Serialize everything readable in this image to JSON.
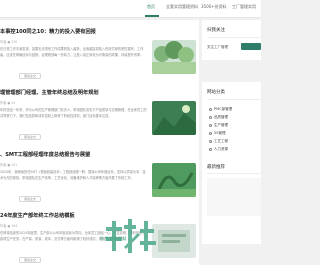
{
  "nav": {
    "items": [
      "首页",
      "全套实用管理资料",
      "3500+份资料",
      "工厂管理实用",
      "工厂"
    ]
  },
  "articles": [
    {
      "title": "本事控100同之10：精力的投入要有回报",
      "meta": "作者 ● 130",
      "summary": "在日常工作中我发现，如果无法带来工作成果的投入越多，反而越容易陷入低效忙碌的恶性循环。工作者，应该先明确目标与回报，合理规划每一份精力，让投入真正转化为可衡量的成果，持续提升效率。"
    },
    {
      "title": "理管理部门经理、主管年终总结及明年规划",
      "meta": "作者 ● 53",
      "summary": "年终总结一年来，作为公司的生产管理部门负责人，带领团队务实于产品质量与交期管理，在全体员工的共同努力下，我们在品质和成本控制上取得了阶段性成效，部门目标基本达成。"
    },
    {
      "title": "、SMT工程部经理年度总结报告与展望",
      "meta": "作者 ● 101",
      "summary": "2020年，我继续担任SMT（表面贴装技术）工程部经理一职，围绕公司年度目标，坚持以质量为本、技术为先的原则，带领团队在生产效率、工艺优化、设备维护和人才培养等方面开展了系统工作。"
    },
    {
      "title": "24年度生产部年终工作总结模板",
      "meta": "作者 ● 194",
      "summary": "在即将结束的2024年度里，生产部以公司年度目标为导向，全体员工团结一心、攻坚克难，顺利完成了各项生产任务，在产量、质量、成本、交付等方面均取得了较好成绩，现将工作总结如下。"
    }
  ],
  "readmore": "阅读全文",
  "watermark": "免费资料下载",
  "sidebar": {
    "follow_title": "扫我关注",
    "follow_text": "关注工厂管理",
    "categories_title": "网站分类",
    "categories": [
      "PMC部管理",
      "品质管理",
      "生产管理",
      "5S管理",
      "工艺工程",
      "人力资源"
    ],
    "recommend_title": "最新推荐"
  },
  "colors": {
    "accent": "#2e7d6b"
  }
}
